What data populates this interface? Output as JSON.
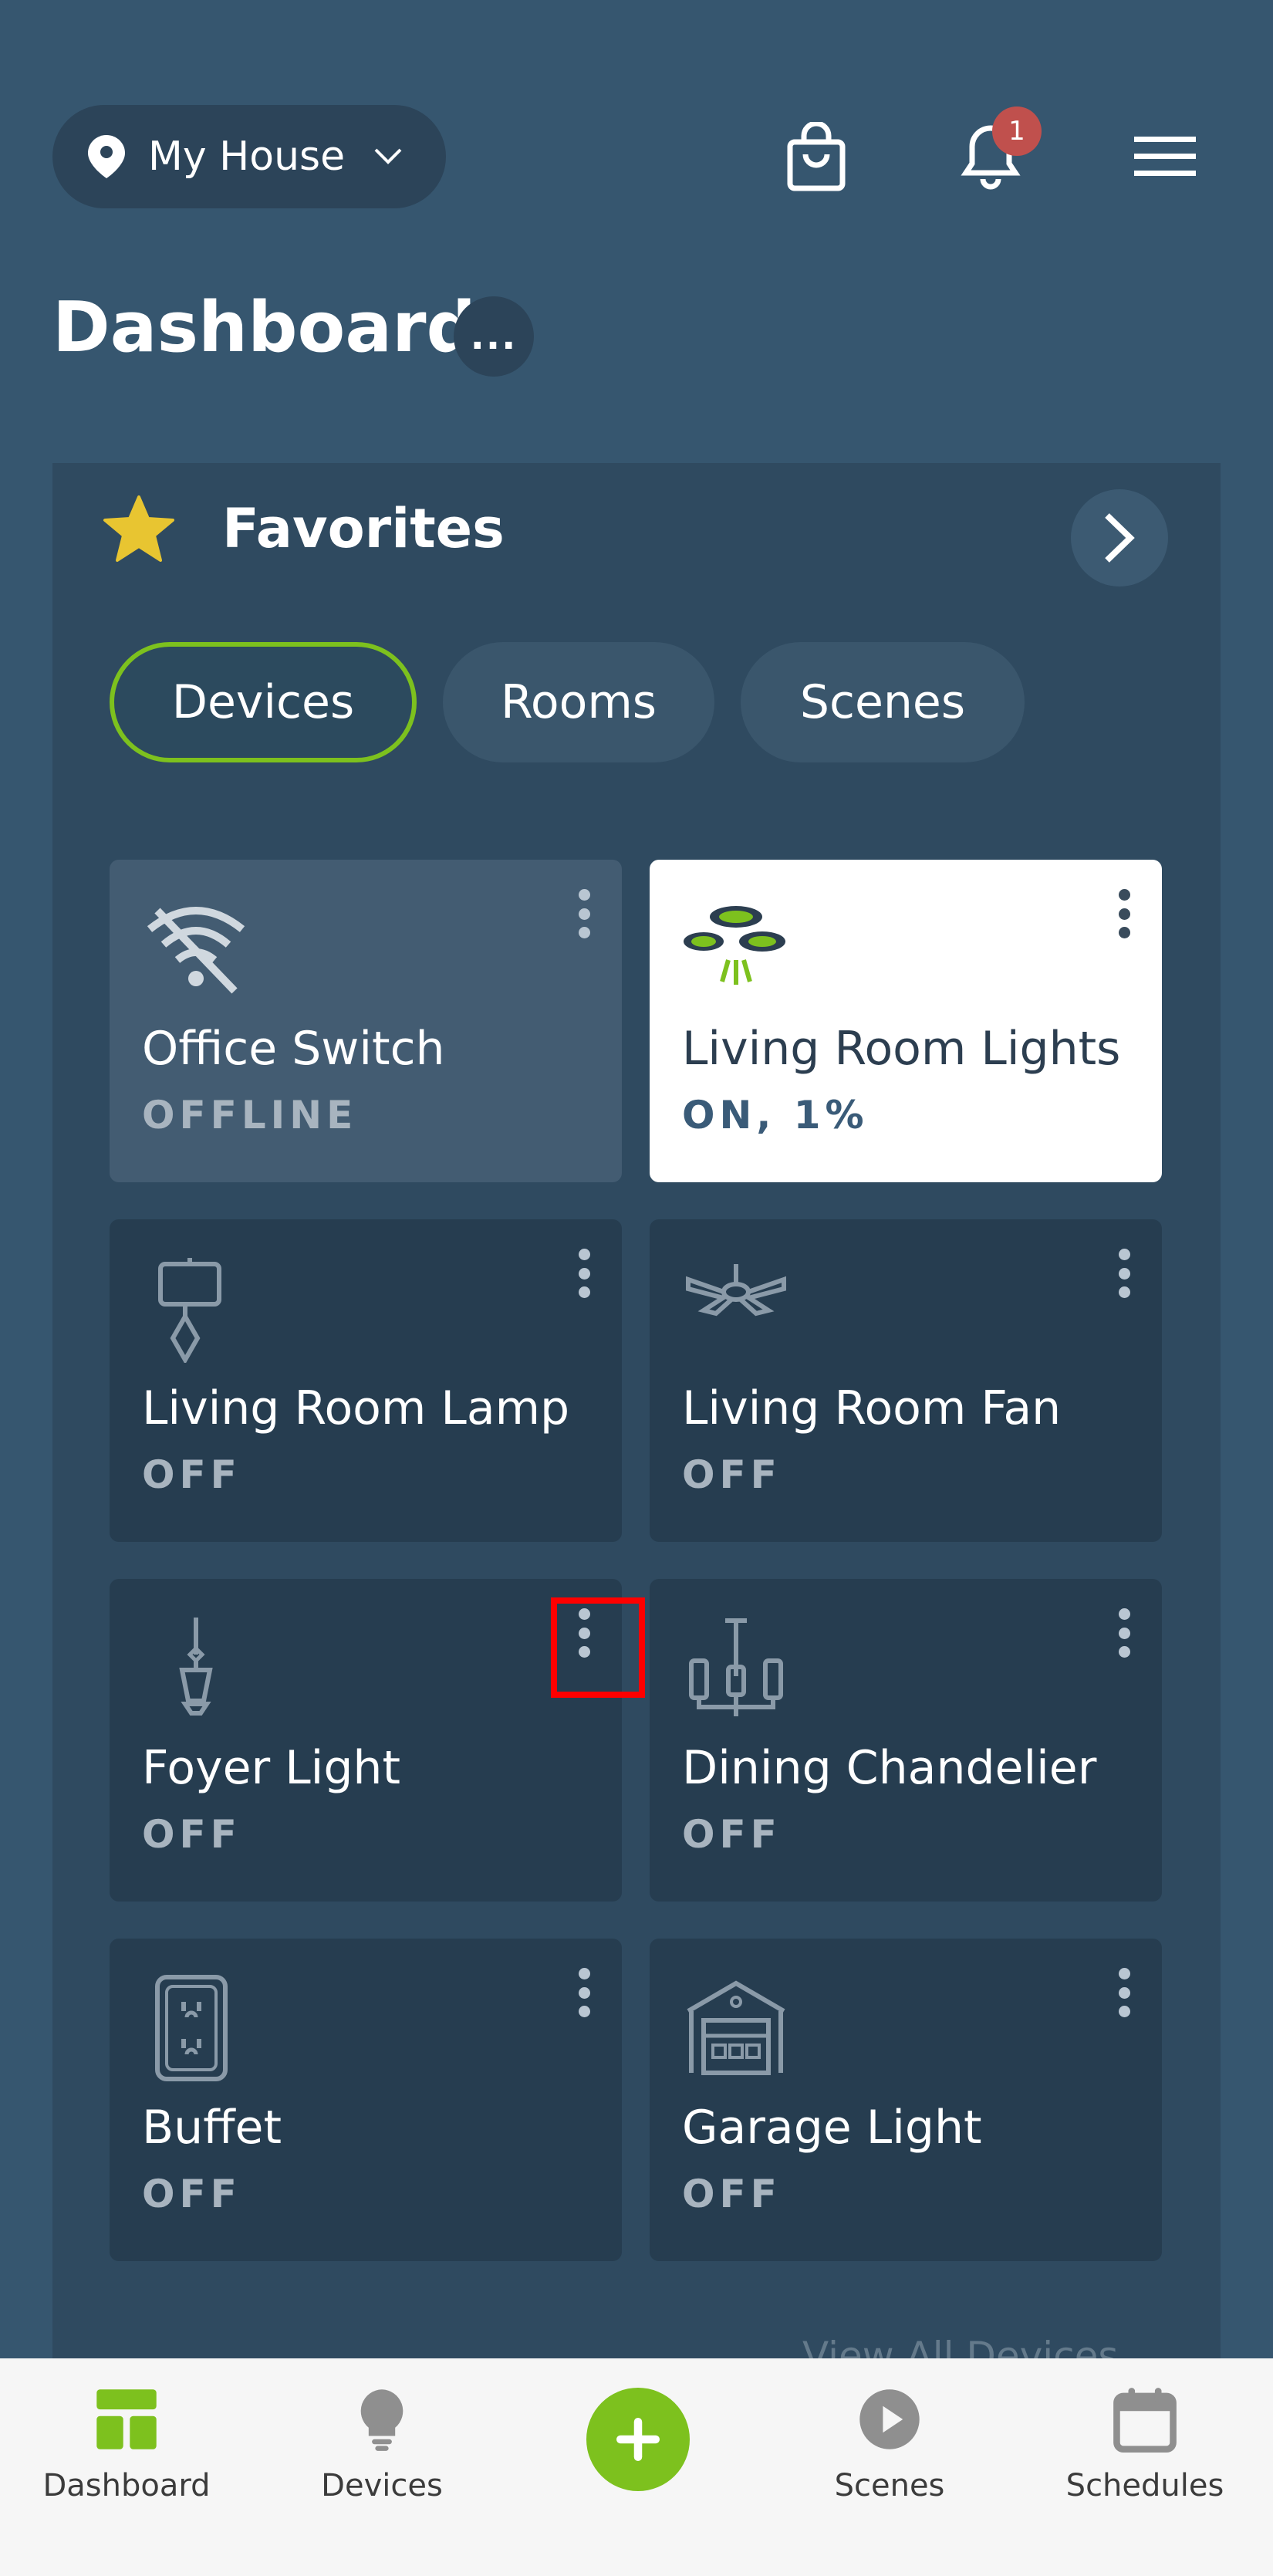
{
  "header": {
    "location": "My House",
    "notification_count": "1"
  },
  "page": {
    "title": "Dashboard",
    "more_label": "..."
  },
  "favorites": {
    "title": "Favorites",
    "tabs": [
      {
        "label": "Devices",
        "active": true
      },
      {
        "label": "Rooms",
        "active": false
      },
      {
        "label": "Scenes",
        "active": false
      }
    ],
    "devices": [
      {
        "name": "Office Switch",
        "state": "OFFLINE",
        "icon": "wifi-off-icon"
      },
      {
        "name": "Living Room Lights",
        "state": "ON, 1%",
        "icon": "ceiling-lights-icon"
      },
      {
        "name": "Living Room Lamp",
        "state": "OFF",
        "icon": "lamp-icon"
      },
      {
        "name": "Living Room Fan",
        "state": "OFF",
        "icon": "ceiling-fan-icon"
      },
      {
        "name": "Foyer Light",
        "state": "OFF",
        "icon": "pendant-light-icon"
      },
      {
        "name": "Dining Chandelier",
        "state": "OFF",
        "icon": "chandelier-icon"
      },
      {
        "name": "Buffet",
        "state": "OFF",
        "icon": "outlet-icon"
      },
      {
        "name": "Garage Light",
        "state": "OFF",
        "icon": "garage-icon"
      }
    ],
    "view_all": "View All Devices"
  },
  "nav": [
    {
      "label": "Dashboard",
      "icon": "dashboard-icon",
      "active": true
    },
    {
      "label": "Devices",
      "icon": "bulb-icon"
    },
    {
      "label": "Scenes",
      "icon": "play-icon"
    },
    {
      "label": "Schedules",
      "icon": "calendar-icon"
    }
  ],
  "colors": {
    "background": "#36566f",
    "panel": "#2f4a60",
    "card": "#263d50",
    "accent": "#7dc11e",
    "badge": "#c0504d",
    "highlight": "#ff0000"
  }
}
